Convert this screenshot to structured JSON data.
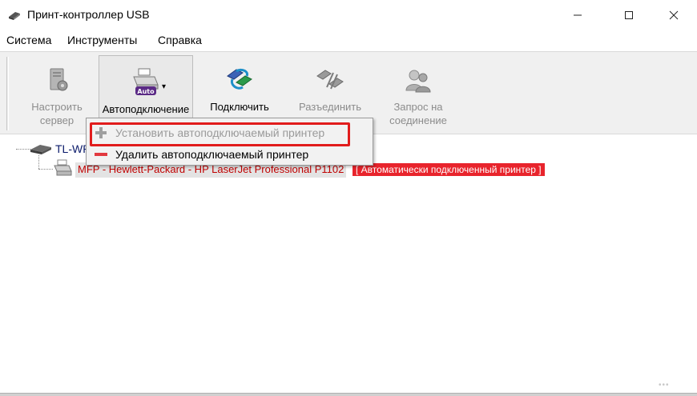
{
  "window": {
    "title": "Принт-контроллер USB",
    "controls": {
      "minimize": "–",
      "maximize": "☐",
      "close": "✕"
    }
  },
  "menu": [
    {
      "label": "Система"
    },
    {
      "label": "Инструменты"
    },
    {
      "label": "Справка"
    }
  ],
  "toolbar": {
    "buttons": [
      {
        "label_line1": "Настроить",
        "label_line2": "сервер",
        "icon": "configure-server-icon",
        "enabled": false
      },
      {
        "label_line1": "Автоподключение",
        "label_line2": "",
        "icon": "auto-connect-printer-icon",
        "icon_text": "Auto",
        "enabled": true,
        "dropdown": "▾"
      },
      {
        "label_line1": "Подключить",
        "label_line2": "",
        "icon": "connect-icon",
        "enabled": true
      },
      {
        "label_line1": "Разъединить",
        "label_line2": "",
        "icon": "disconnect-icon",
        "enabled": false
      },
      {
        "label_line1": "Запрос на",
        "label_line2": "соединение",
        "icon": "request-connection-icon",
        "enabled": false
      }
    ]
  },
  "tree": {
    "server_label": "TL-WR",
    "printer_label": "MFP - Hewlett-Packard - HP LaserJet Professional P1102",
    "printer_status": "[ Автоматически подключенный принтер ]"
  },
  "popup_menu": {
    "items": [
      {
        "label": "Установить автоподключаемый принтер",
        "icon": "plus-icon",
        "enabled": false
      },
      {
        "label": "Удалить автоподключаемый принтер",
        "icon": "minus-icon",
        "enabled": true
      }
    ]
  },
  "colors": {
    "highlight": "#e11c1c",
    "status_badge": "#e8242c",
    "printer_text": "#c00000",
    "server_text": "#0a1a6a"
  },
  "watermark": "•••"
}
